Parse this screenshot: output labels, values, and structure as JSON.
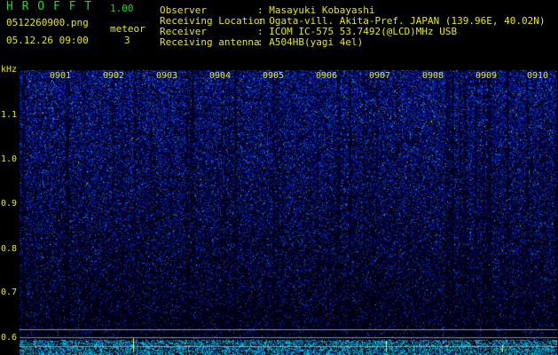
{
  "app": {
    "title": "H R O F F T",
    "version": "1.00",
    "file_name": "0512260900.png",
    "meteor_label": "meteor",
    "meteor_count": "3",
    "date_time": "05.12.26 09:00"
  },
  "info": {
    "observer_label": "Observer",
    "observer_value": ": Masayuki Kobayashi",
    "location_label": "Receiving Location",
    "location_value": ": Ogata-vill. Akita-Pref. JAPAN (139.96E, 40.02N)",
    "receiver_label": "Receiver",
    "receiver_value": ": ICOM IC-575 53.7492(@LCD)MHz USB",
    "antenna_label": "Receiving antenna",
    "antenna_value": ": A504HB(yagi 4el)"
  },
  "axis": {
    "unit": "kHz",
    "y_ticks": [
      "1.1",
      "1.0",
      "0.9",
      "0.8",
      "0.7",
      "0.6"
    ],
    "time_labels": [
      "0901",
      "0902",
      "0903",
      "0904",
      "0905",
      "0906",
      "0907",
      "0908",
      "0909",
      "0910"
    ]
  },
  "colors": {
    "header_green": "#27d03a",
    "label_yellow": "#e6e61e",
    "spectrogram_blue": "#1f48d8"
  }
}
